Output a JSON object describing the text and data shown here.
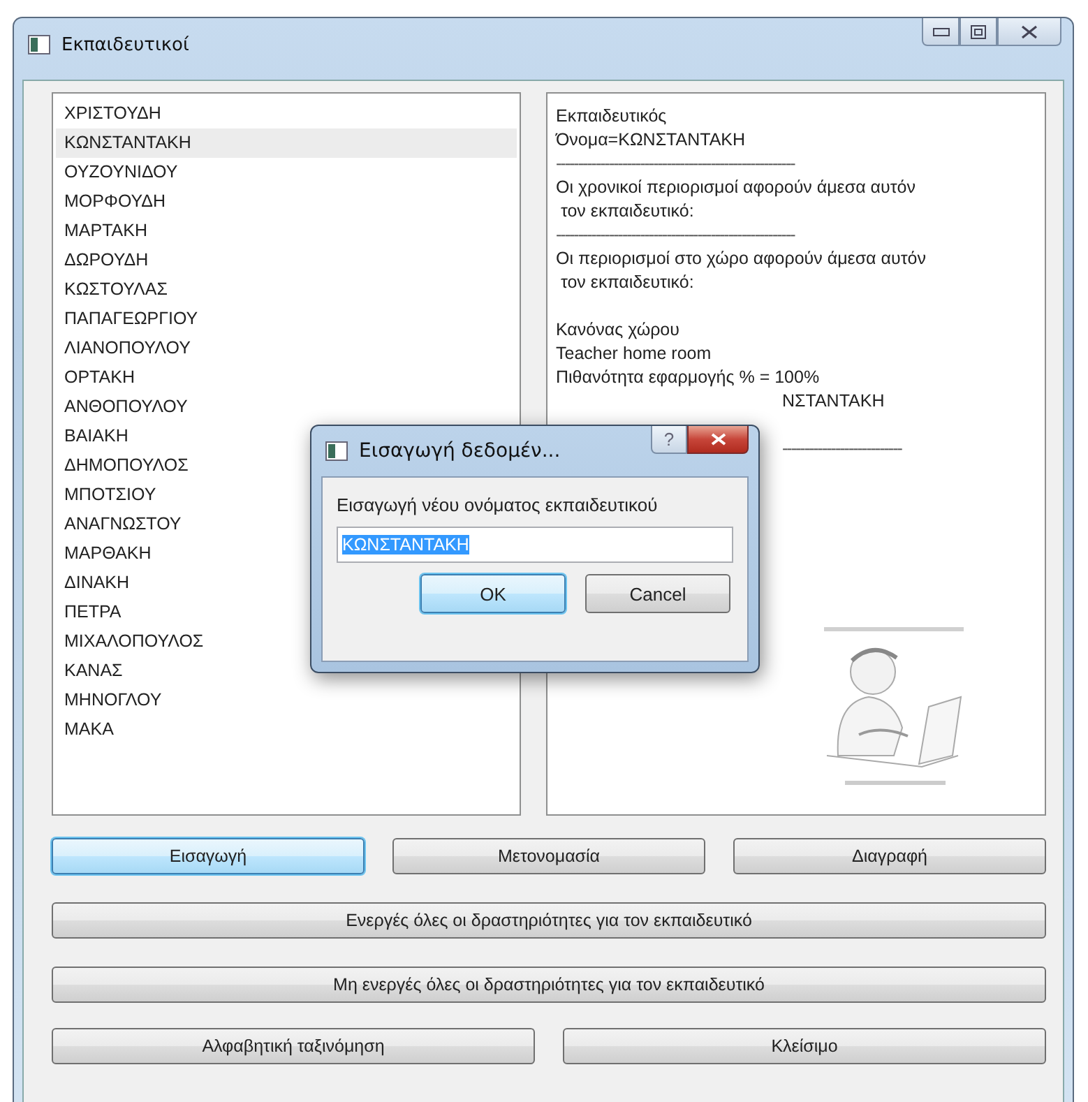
{
  "window": {
    "title": "Εκπαιδευτικοί"
  },
  "teachers": [
    {
      "name": "ΧΡΙΣΤΟΥΔΗ",
      "selected": false
    },
    {
      "name": "ΚΩΝΣΤΑΝΤΑΚΗ",
      "selected": true
    },
    {
      "name": "ΟΥΖΟΥΝΙΔΟΥ",
      "selected": false
    },
    {
      "name": "ΜΟΡΦΟΥΔΗ",
      "selected": false
    },
    {
      "name": "ΜΑΡΤΑΚΗ",
      "selected": false
    },
    {
      "name": "ΔΩΡΟΥΔΗ",
      "selected": false
    },
    {
      "name": "ΚΩΣΤΟΥΛΑΣ",
      "selected": false
    },
    {
      "name": "ΠΑΠΑΓΕΩΡΓΙΟΥ",
      "selected": false
    },
    {
      "name": "ΛΙΑΝΟΠΟΥΛΟΥ",
      "selected": false
    },
    {
      "name": "ΟΡΤΑΚΗ",
      "selected": false
    },
    {
      "name": "ΑΝΘΟΠΟΥΛΟΥ",
      "selected": false
    },
    {
      "name": "ΒΑΙΑΚΗ",
      "selected": false
    },
    {
      "name": "ΔΗΜΟΠΟΥΛΟΣ",
      "selected": false
    },
    {
      "name": "ΜΠΟΤΣΙΟΥ",
      "selected": false
    },
    {
      "name": "ΑΝΑΓΝΩΣΤΟΥ",
      "selected": false
    },
    {
      "name": "ΜΑΡΘΑΚΗ",
      "selected": false
    },
    {
      "name": "ΔΙΝΑΚΗ",
      "selected": false
    },
    {
      "name": "ΠΕΤΡΑ",
      "selected": false
    },
    {
      "name": "ΜΙΧΑΛΟΠΟΥΛΟΣ",
      "selected": false
    },
    {
      "name": "ΚΑΝΑΣ",
      "selected": false
    },
    {
      "name": "ΜΗΝΟΓΛΟΥ",
      "selected": false
    },
    {
      "name": "ΜΑΚΑ",
      "selected": false
    }
  ],
  "info": [
    {
      "kind": "text",
      "text": "Εκπαιδευτικός"
    },
    {
      "kind": "text",
      "text": "Όνομα=ΚΩΝΣΤΑΝΤΑΚΗ"
    },
    {
      "kind": "rule",
      "text": "------------------------------------------------------"
    },
    {
      "kind": "text",
      "text": "Οι χρονικοί περιορισμοί αφορούν άμεσα αυτόν\n τον εκπαιδευτικό:"
    },
    {
      "kind": "rule",
      "text": "------------------------------------------------------"
    },
    {
      "kind": "text",
      "text": "Οι περιορισμοί στο χώρο αφορούν άμεσα αυτόν\n τον εκπαιδευτικό:"
    },
    {
      "kind": "gap"
    },
    {
      "kind": "text",
      "text": "Κανόνας χώρου"
    },
    {
      "kind": "text",
      "text": "Teacher home room"
    },
    {
      "kind": "text",
      "text": "Πιθανότητα εφαρμογής % = 100%"
    },
    {
      "kind": "partial",
      "text": "ΝΣΤΑΝΤΑΚΗ"
    },
    {
      "kind": "gap"
    },
    {
      "kind": "partial-rule",
      "text": "---------------------------"
    }
  ],
  "buttons": [
    {
      "label": "Εισαγωγή",
      "focused": true
    },
    {
      "label": "Μετονομασία",
      "focused": false
    },
    {
      "label": "Διαγραφή",
      "focused": false
    }
  ],
  "wide_buttons": [
    {
      "label": "Ενεργές όλες οι δραστηριότητες για τον εκπαιδευτικό"
    },
    {
      "label": "Μη ενεργές όλες οι δραστηριότητες για τον εκπαιδευτικό"
    }
  ],
  "bottom_buttons": [
    {
      "label": "Αλφαβητική ταξινόμηση"
    },
    {
      "label": "Κλείσιμο"
    }
  ],
  "dialog": {
    "title": "Εισαγωγή δεδομέν...",
    "help": "?",
    "prompt": "Εισαγωγή νέου ονόματος εκπαιδευτικού",
    "value": "ΚΩΝΣΤΑΝΤΑΚΗ",
    "value_selected": true,
    "buttons": [
      {
        "label": "OK",
        "focused": true
      },
      {
        "label": "Cancel",
        "focused": false
      }
    ]
  }
}
